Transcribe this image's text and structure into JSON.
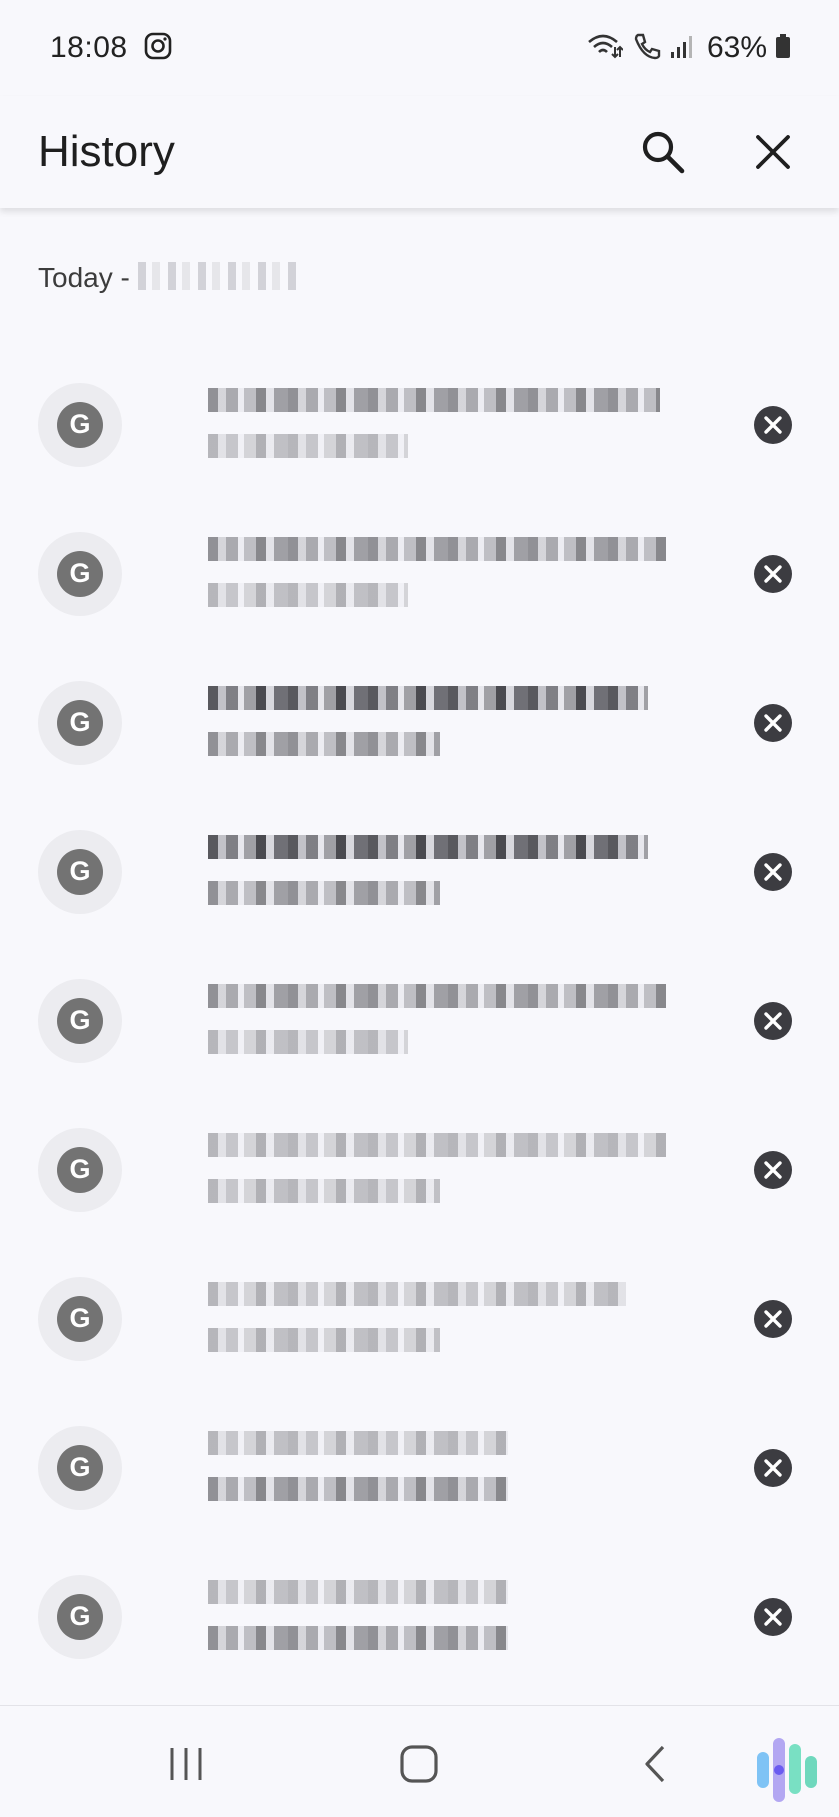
{
  "status_bar": {
    "time": "18:08",
    "battery": "63%",
    "icons": [
      "instagram-icon",
      "wifi-calling-icon",
      "call-icon",
      "signal-icon",
      "battery-icon"
    ]
  },
  "app_bar": {
    "title": "History",
    "actions": [
      "search-icon",
      "close-icon"
    ]
  },
  "history": {
    "section_label": "Today - ",
    "items": [
      {
        "favicon_letter": "G"
      },
      {
        "favicon_letter": "G"
      },
      {
        "favicon_letter": "G"
      },
      {
        "favicon_letter": "G"
      },
      {
        "favicon_letter": "G"
      },
      {
        "favicon_letter": "G"
      },
      {
        "favicon_letter": "G"
      },
      {
        "favicon_letter": "G"
      },
      {
        "favicon_letter": "G"
      }
    ]
  },
  "nav_bar": {
    "buttons": [
      "recent-apps-icon",
      "home-icon",
      "back-icon"
    ]
  },
  "colors": {
    "background": "#f8f8fc",
    "favicon_bg": "#737373",
    "remove_button": "#3c3c41"
  }
}
